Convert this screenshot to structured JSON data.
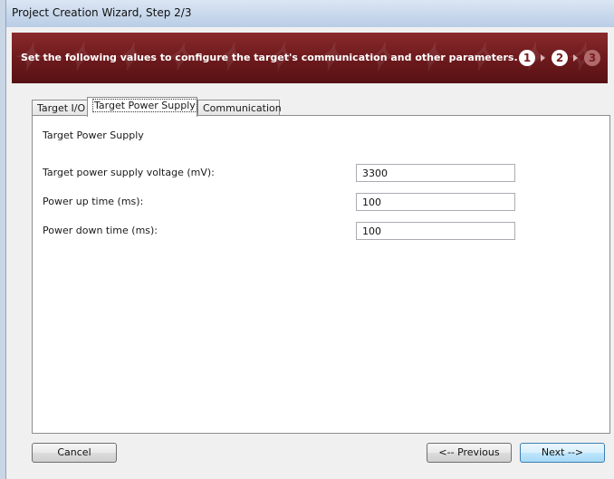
{
  "window": {
    "title": "Project Creation Wizard, Step 2/3"
  },
  "banner": {
    "message": "Set the following values to configure the target's communication and other parameters.",
    "steps": [
      "1",
      "2",
      "3"
    ]
  },
  "tabs": [
    {
      "label": "Target I/O"
    },
    {
      "label": "Target Power Supply"
    },
    {
      "label": "Communication"
    }
  ],
  "panel": {
    "section_title": "Target Power Supply",
    "fields": [
      {
        "label": "Target power supply voltage (mV):",
        "value": "3300"
      },
      {
        "label": "Power up time (ms):",
        "value": "100"
      },
      {
        "label": "Power down time (ms):",
        "value": "100"
      }
    ]
  },
  "buttons": {
    "cancel": "Cancel",
    "previous": "<-- Previous",
    "next": "Next -->"
  },
  "colors": {
    "banner": "#6e1a1d",
    "accent_next": "#3c7fb1"
  }
}
